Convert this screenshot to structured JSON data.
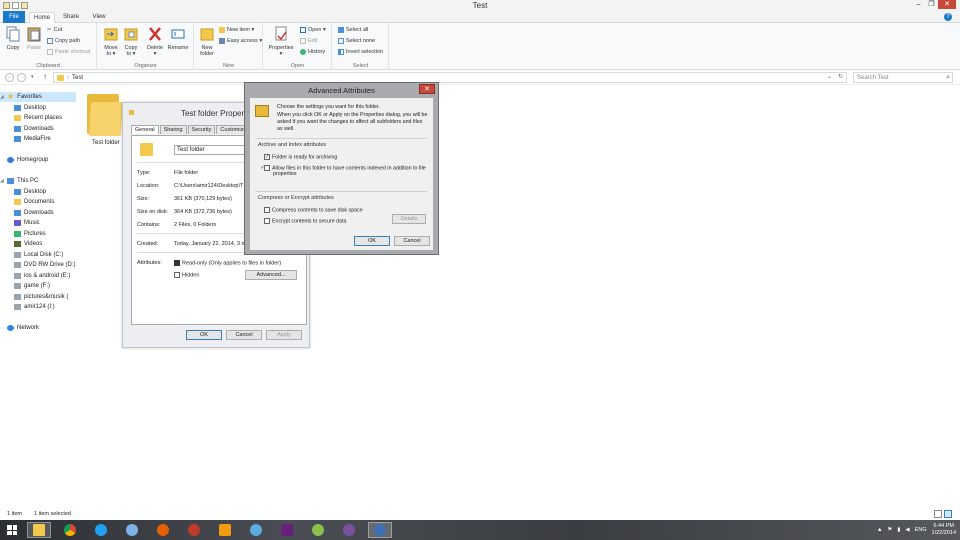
{
  "window": {
    "title": "Test",
    "buttons": [
      "–",
      "❐",
      "✕"
    ]
  },
  "ribbon_tabs": {
    "file": "File",
    "home": "Home",
    "share": "Share",
    "view": "View"
  },
  "ribbon": {
    "clipboard": {
      "label": "Clipboard",
      "copy": "Copy",
      "paste": "Paste",
      "cut": "Cut",
      "copy_path": "Copy path",
      "paste_shortcut": "Paste shortcut"
    },
    "organize": {
      "label": "Organize",
      "move_to": "Move",
      "move_to2": "to ▾",
      "copy_to": "Copy",
      "copy_to2": "to ▾",
      "delete": "Delete",
      "delete2": "▾",
      "rename": "Rename"
    },
    "new": {
      "label": "New",
      "new_folder": "New",
      "new_folder2": "folder",
      "new_item": "New item ▾",
      "easy_access": "Easy access ▾"
    },
    "open": {
      "label": "Open",
      "properties": "Properties",
      "properties2": "▾",
      "open": "Open ▾",
      "edit": "Edit",
      "history": "History"
    },
    "select": {
      "label": "Select",
      "select_all": "Select all",
      "select_none": "Select none",
      "invert": "Invert selection"
    }
  },
  "address": {
    "path": "Test",
    "search_placeholder": "Search Test"
  },
  "nav": {
    "favorites": "Favorites",
    "desktop": "Desktop",
    "recent_places": "Recent places",
    "downloads": "Downloads",
    "mediafire": "MediaFire",
    "homegroup": "Homegroup",
    "this_pc": "This PC",
    "pc_desktop": "Desktop",
    "documents": "Documents",
    "pc_downloads": "Downloads",
    "music": "Music",
    "pictures": "Pictures",
    "videos": "Videos",
    "local_disk": "Local Disk (C:)",
    "dvd": "DVD RW Drive (D:)",
    "ios_android": "ios & android (E:)",
    "game": "game (F:)",
    "pictures_musik": "pictures&musik (",
    "amir": "amir124 (I:)",
    "network": "Network"
  },
  "content": {
    "folder_name": "Test folder"
  },
  "properties_dialog": {
    "title": "Test folder Propert",
    "tabs": [
      "General",
      "Sharing",
      "Security",
      "Customize"
    ],
    "name_value": "Test folder",
    "type_label": "Type:",
    "type_value": "File folder",
    "location_label": "Location:",
    "location_value": "C:\\Users\\amir124\\Desktop\\T",
    "size_label": "Size:",
    "size_value": "361 KB (370,129 bytes)",
    "size_disk_label": "Size on disk:",
    "size_disk_value": "364 KB (372,736 bytes)",
    "contains_label": "Contains:",
    "contains_value": "2 Files, 0 Folders",
    "created_label": "Created:",
    "created_value": "Today, January 22, 2014, 3 m",
    "attributes_label": "Attributes:",
    "readonly_label": "Read-only (Only applies to files in folder)",
    "hidden_label": "Hidden",
    "advanced_button": "Advanced...",
    "ok": "OK",
    "cancel": "Cancel",
    "apply": "Apply"
  },
  "advanced_dialog": {
    "title": "Advanced Attributes",
    "close": "✕",
    "intro_line1": "Choose the settings you want for this folder.",
    "intro_line2": "When you click OK or Apply on the Properties dialog, you will be asked if you want the changes to affect all subfolders and files as well.",
    "archive_group": "Archive and Index attributes",
    "archiving_label": "Folder is ready for archiving",
    "indexing_label": "Allow files in this folder to have contents indexed in addition to file properties",
    "compress_group": "Compress or Encrypt attributes",
    "compress_label": "Compress contents to save disk space",
    "encrypt_label": "Encrypt contents to secure data",
    "details_button": "Details",
    "ok": "OK",
    "cancel": "Cancel"
  },
  "status": {
    "items": "1 item",
    "selected": "1 item selected"
  },
  "taskbar": {
    "lang": "ENG",
    "time": "6:44 PM",
    "date": "1/22/2014"
  }
}
